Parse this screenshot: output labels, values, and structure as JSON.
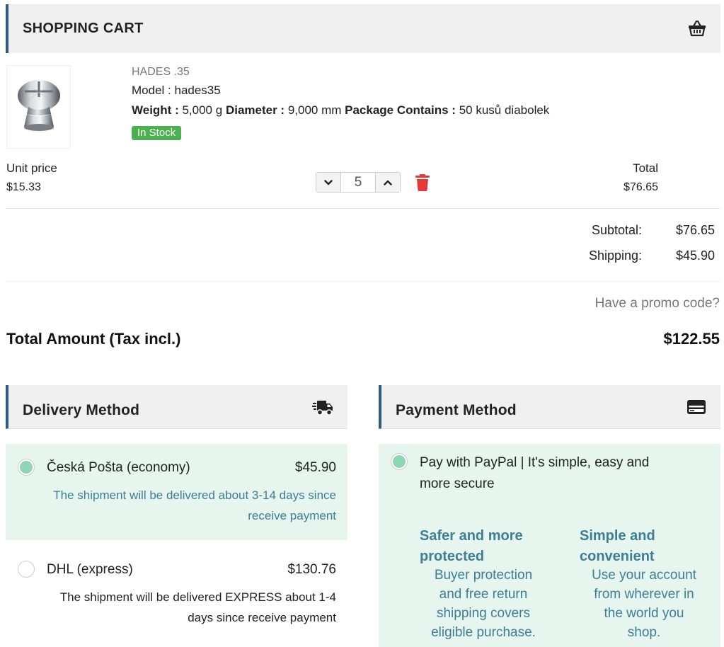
{
  "cart": {
    "title": "SHOPPING CART",
    "icon": "basket-icon"
  },
  "product": {
    "name": "HADES .35",
    "model_label": "Model :",
    "model": "hades35",
    "weight_label": "Weight :",
    "weight": "5,000 g",
    "diameter_label": "Diameter :",
    "diameter": "9,000 mm",
    "package_label": "Package Contains :",
    "package": "50 kusů diabolek",
    "stock": "In Stock",
    "unit_price_label": "Unit price",
    "unit_price": "$15.33",
    "quantity": "5",
    "total_label": "Total",
    "total": "$76.65"
  },
  "summary": {
    "subtotal_label": "Subtotal:",
    "subtotal": "$76.65",
    "shipping_label": "Shipping:",
    "shipping": "$45.90",
    "promo": "Have a promo code?",
    "total_label": "Total Amount (Tax incl.)",
    "total": "$122.55"
  },
  "delivery": {
    "title": "Delivery Method",
    "icon": "truck-icon",
    "options": [
      {
        "name": "Česká Pošta (economy)",
        "price": "$45.90",
        "desc1": "The shipment will be delivered about 3-14 days since",
        "desc2": "receive payment",
        "selected": true
      },
      {
        "name": "DHL (express)",
        "price": "$130.76",
        "desc1": "The shipment will be delivered EXPRESS about 1-4",
        "desc2": "days since receive payment",
        "selected": false
      }
    ]
  },
  "payment": {
    "title": "Payment Method",
    "icon": "credit-card-icon",
    "option": {
      "line1": "Pay with PayPal | It's simple, easy and",
      "line2": "more secure",
      "selected": true
    },
    "features": [
      {
        "title1": "Safer and more",
        "title2": "protected",
        "text": [
          "Buyer protection",
          "and free return",
          "shipping covers",
          "eligible purchase."
        ]
      },
      {
        "title1": "Simple and",
        "title2": "convenient",
        "text": [
          "Use your account",
          "from wherever in",
          "the world you",
          "shop."
        ]
      }
    ]
  },
  "colors": {
    "accent": "#2b5c88",
    "stock_green": "#4caf50",
    "selected_bg": "#e6f6ef",
    "radio_dot": "#8fd6b4",
    "info_blue": "#3d7e93",
    "trash_red": "#e53935"
  }
}
